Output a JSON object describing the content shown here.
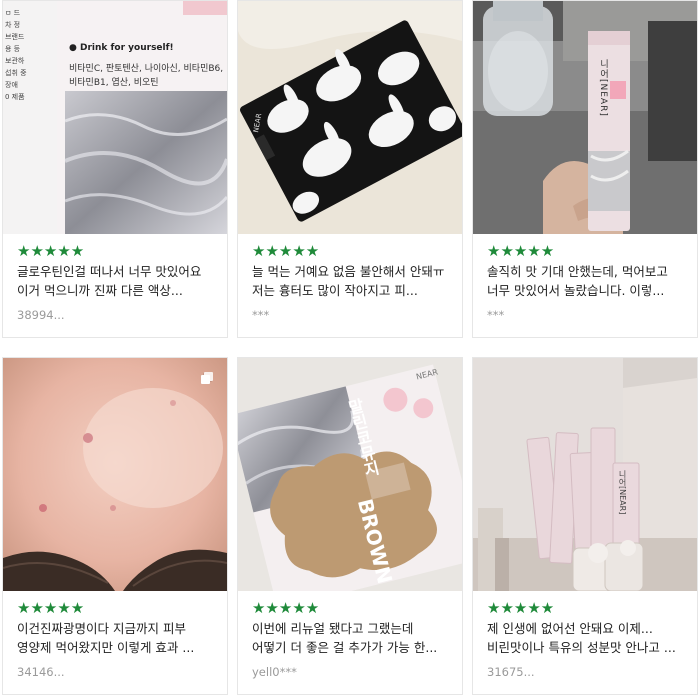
{
  "reviews": [
    {
      "stars": "★★★★★",
      "text": "글로우틴인걸 떠나서 너무 맛있어요 이거 먹으니까 진짜 다른 액상...",
      "author": "38994...",
      "image_text": {
        "drink": "● Drink for yourself!",
        "line1": "비타민C, 판토텐산, 나이아신, 비타민B6,",
        "line2": "비타민B1, 엽산, 비오틴"
      }
    },
    {
      "stars": "★★★★★",
      "text": "늘 먹는 거예요 없음 불안해서 안돼ㅠ 저는 흉터도 많이 작아지고 피...",
      "author": "***",
      "image_text": {
        "tag": "NEAR"
      }
    },
    {
      "stars": "★★★★★",
      "text": "솔직히 맛 기대 안했는데, 먹어보고 너무 맛있어서 놀랐습니다. 이렇...",
      "author": "***",
      "image_text": {
        "stick": "니어[NEAR]"
      }
    },
    {
      "stars": "★★★★★",
      "text": "이건진짜광명이다 지금까지 피부 영양제 먹어왔지만 이렇게 효과 ...",
      "author": "34146...",
      "image_text": {}
    },
    {
      "stars": "★★★★★",
      "text": "이번에 리뉴얼 됐다고 그랬는데 어떻기 더 좋은 걸 추가가 가능 한...",
      "author": "yell0***",
      "image_text": {
        "brand": "NEAR",
        "title": "말린코뮤지",
        "flavor": "BROWN"
      }
    },
    {
      "stars": "★★★★★",
      "text": "제 인생에 없어선 안돼요 이제... 비린맛이나 특유의 성분맛 안나고 ...",
      "author": "31675...",
      "image_text": {
        "stick": "니어[NEAR]"
      }
    }
  ],
  "colors": {
    "star": "#1f8a3a",
    "border": "#e6e6e6",
    "author": "#9a9a9a"
  },
  "icons": {
    "multi_image": "multi-image-icon"
  }
}
